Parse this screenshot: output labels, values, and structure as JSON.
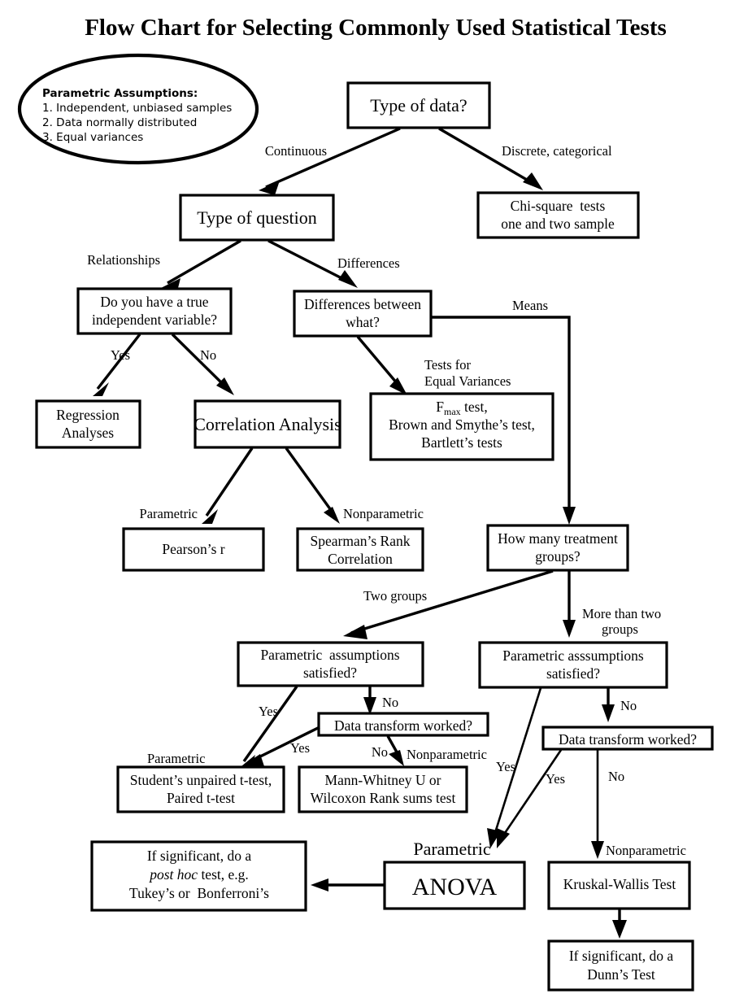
{
  "title": "Flow Chart for Selecting Commonly Used Statistical Tests",
  "assumptions_note": {
    "heading": "Parametric Assumptions:",
    "items": [
      "1. Independent, unbiased samples",
      "2. Data normally distributed",
      "3. Equal variances"
    ]
  },
  "nodes": {
    "type_of_data": {
      "line1": "Type of data?"
    },
    "chi_square": {
      "line1": "Chi-square  tests",
      "line2": "one and two sample"
    },
    "type_of_question": {
      "line1": "Type of question"
    },
    "true_iv": {
      "line1": "Do you have a true",
      "line2": "independent variable?"
    },
    "diff_between": {
      "line1": "Differences between",
      "line2": "what?"
    },
    "regression": {
      "line1": "Regression",
      "line2": "Analyses"
    },
    "correlation": {
      "line1": "Correlation Analysis"
    },
    "equal_var_tests": {
      "line1a": "F",
      "line1b": "max",
      "line1c": " test,",
      "line2": "Brown and Smythe’s test,",
      "line3": "Bartlett’s tests"
    },
    "pearson": {
      "line1": "Pearson’s r"
    },
    "spearman": {
      "line1": "Spearman’s Rank",
      "line2": "Correlation"
    },
    "how_many_groups": {
      "line1": "How many treatment",
      "line2": "groups?"
    },
    "param_assump_two": {
      "line1": "Parametric  assumptions",
      "line2": "satisfied?"
    },
    "param_assump_multi": {
      "line1": "Parametric asssumptions",
      "line2": "satisfied?"
    },
    "transform_two": {
      "line1": "Data transform worked?"
    },
    "transform_multi": {
      "line1": "Data transform worked?"
    },
    "t_tests": {
      "line1": "Student’s unpaired t-test,",
      "line2": "Paired t-test"
    },
    "mann_whitney": {
      "line1": "Mann-Whitney U or",
      "line2": "Wilcoxon Rank sums test"
    },
    "post_hoc": {
      "line1": "If significant, do a",
      "line2a": "post hoc",
      "line2b": " test, e.g.",
      "line3": "Tukey’s or  Bonferroni’s"
    },
    "anova": {
      "line1": "ANOVA"
    },
    "kruskal": {
      "line1": "Kruskal-Wallis Test"
    },
    "dunn": {
      "line1": "If significant, do a",
      "line2": "Dunn’s Test"
    }
  },
  "edge_labels": {
    "continuous": "Continuous",
    "discrete": "Discrete, categorical",
    "relationships": "Relationships",
    "differences": "Differences",
    "means": "Means",
    "yes_iv": "Yes",
    "no_iv": "No",
    "tests_for": "Tests for",
    "equal_variances": "Equal Variances",
    "parametric_corr": "Parametric",
    "nonparametric_corr": "Nonparametric",
    "two_groups": "Two groups",
    "more_than_two": "More than two",
    "groups": "groups",
    "yes_two_assump": "Yes",
    "no_two_assump": "No",
    "yes_two_transform": "Yes",
    "no_two_transform": "No",
    "nonparametric_two": "Nonparametric",
    "parametric_two": "Parametric",
    "yes_multi_assump": "Yes",
    "no_multi_assump": "No",
    "yes_multi_transform": "Yes",
    "no_multi_transform": "No",
    "parametric_anova": "Parametric",
    "nonparametric_kruskal": "Nonparametric"
  },
  "colors": {
    "stroke": "#000000",
    "fill": "#ffffff",
    "text": "#000000"
  },
  "chart_data": {
    "type": "diagram",
    "title": "Flow Chart for Selecting Commonly Used Statistical Tests",
    "flow": [
      {
        "from": "Type of data?",
        "to": "Type of question",
        "label": "Continuous"
      },
      {
        "from": "Type of data?",
        "to": "Chi-square tests one and two sample",
        "label": "Discrete, categorical"
      },
      {
        "from": "Type of question",
        "to": "Do you have a true independent variable?",
        "label": "Relationships"
      },
      {
        "from": "Type of question",
        "to": "Differences between what?",
        "label": "Differences"
      },
      {
        "from": "Do you have a true independent variable?",
        "to": "Regression Analyses",
        "label": "Yes"
      },
      {
        "from": "Do you have a true independent variable?",
        "to": "Correlation Analysis",
        "label": "No"
      },
      {
        "from": "Differences between what?",
        "to": "Fmax test, Brown and Smythe's test, Bartlett's tests",
        "label": "Tests for Equal Variances"
      },
      {
        "from": "Differences between what?",
        "to": "How many treatment groups?",
        "label": "Means"
      },
      {
        "from": "Correlation Analysis",
        "to": "Pearson's r",
        "label": "Parametric"
      },
      {
        "from": "Correlation Analysis",
        "to": "Spearman's Rank Correlation",
        "label": "Nonparametric"
      },
      {
        "from": "How many treatment groups?",
        "to": "Parametric assumptions satisfied? (two)",
        "label": "Two groups"
      },
      {
        "from": "How many treatment groups?",
        "to": "Parametric asssumptions satisfied? (multi)",
        "label": "More than two groups"
      },
      {
        "from": "Parametric assumptions satisfied? (two)",
        "to": "Student's unpaired t-test, Paired t-test",
        "label": "Yes / Parametric"
      },
      {
        "from": "Parametric assumptions satisfied? (two)",
        "to": "Data transform worked? (two)",
        "label": "No"
      },
      {
        "from": "Data transform worked? (two)",
        "to": "Student's unpaired t-test, Paired t-test",
        "label": "Yes"
      },
      {
        "from": "Data transform worked? (two)",
        "to": "Mann-Whitney U or Wilcoxon Rank sums test",
        "label": "No / Nonparametric"
      },
      {
        "from": "Parametric asssumptions satisfied? (multi)",
        "to": "ANOVA",
        "label": "Yes"
      },
      {
        "from": "Parametric asssumptions satisfied? (multi)",
        "to": "Data transform worked? (multi)",
        "label": "No"
      },
      {
        "from": "Data transform worked? (multi)",
        "to": "ANOVA",
        "label": "Yes / Parametric"
      },
      {
        "from": "Data transform worked? (multi)",
        "to": "Kruskal-Wallis Test",
        "label": "No / Nonparametric"
      },
      {
        "from": "ANOVA",
        "to": "If significant, do a post hoc test, e.g. Tukey's or Bonferroni's",
        "label": ""
      },
      {
        "from": "Kruskal-Wallis Test",
        "to": "If significant, do a Dunn's Test",
        "label": ""
      }
    ]
  }
}
